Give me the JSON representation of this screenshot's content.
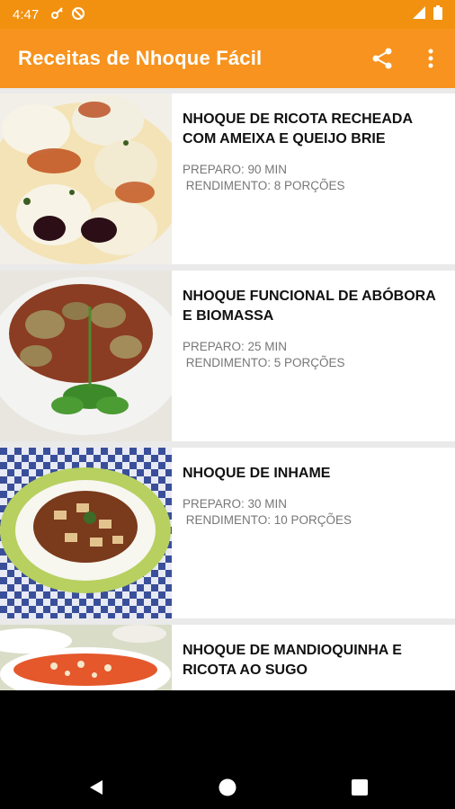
{
  "status_bar": {
    "time": "4:47",
    "icons": [
      "key-icon",
      "sync-icon",
      "signal-icon",
      "battery-icon"
    ]
  },
  "app_bar": {
    "title": "Receitas de Nhoque Fácil",
    "actions": [
      "share-icon",
      "more-vert-icon"
    ]
  },
  "recipes": [
    {
      "name": "NHOQUE DE RICOTA RECHEADA COM AMEIXA E QUEIJO BRIE",
      "preparo": "PREPARO: 90 MIN",
      "rendimento": " RENDIMENTO: 8 PORÇÕES"
    },
    {
      "name": "NHOQUE FUNCIONAL DE ABÓBORA E BIOMASSA",
      "preparo": "PREPARO: 25 MIN",
      "rendimento": " RENDIMENTO: 5 PORÇÕES"
    },
    {
      "name": "NHOQUE DE INHAME",
      "preparo": "PREPARO: 30 MIN",
      "rendimento": " RENDIMENTO: 10 PORÇÕES"
    },
    {
      "name": "NHOQUE DE MANDIOQUINHA E RICOTA AO SUGO",
      "preparo": "",
      "rendimento": ""
    }
  ],
  "colors": {
    "status_bar": "#f29110",
    "app_bar": "#f7931e",
    "list_bg": "#eaeaea",
    "title_text": "#111111",
    "meta_text": "#777777"
  },
  "nav_bar": {
    "buttons": [
      "back-icon",
      "home-icon",
      "recents-icon"
    ]
  }
}
